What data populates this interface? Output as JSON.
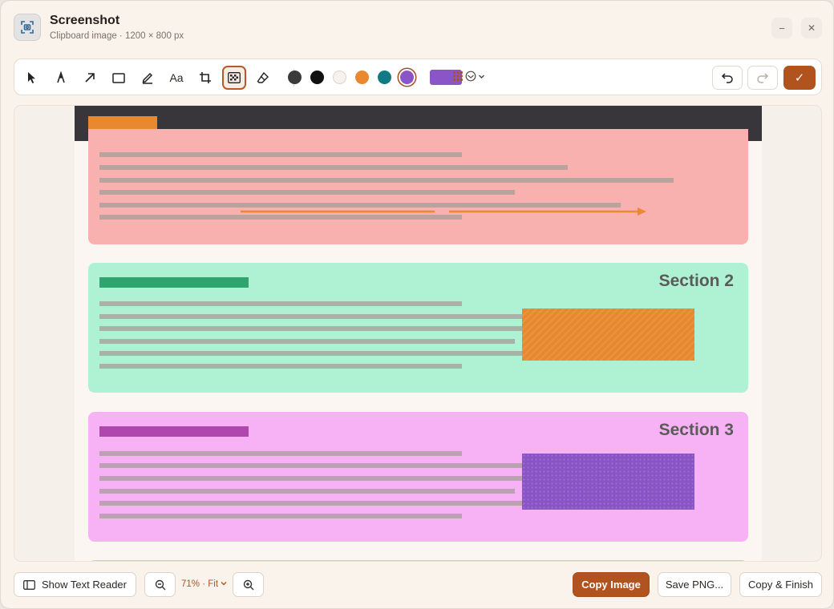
{
  "window": {
    "title": "Screenshot",
    "subtitle": "Clipboard image · 1200 × 800 px",
    "minimize_glyph": "−",
    "close_glyph": "✕",
    "app_icon": "screenshot-icon"
  },
  "toolbar": {
    "tools": [
      {
        "name": "select",
        "icon": "cursor-icon",
        "active": false
      },
      {
        "name": "pen",
        "icon": "pen-nib-icon",
        "active": false
      },
      {
        "name": "arrow",
        "icon": "arrow-icon",
        "active": false
      },
      {
        "name": "rectangle",
        "icon": "rectangle-icon",
        "active": false
      },
      {
        "name": "highlighter",
        "icon": "highlighter-icon",
        "active": false
      },
      {
        "name": "text",
        "label": "Aa",
        "active": false
      },
      {
        "name": "crop",
        "icon": "crop-icon",
        "active": false
      },
      {
        "name": "pixelate",
        "icon": "pixelate-icon",
        "active": true
      },
      {
        "name": "eraser",
        "icon": "eraser-icon",
        "active": false
      }
    ],
    "colors": [
      "#3a3a3c",
      "#111111",
      "#f7f2ee",
      "#e8892f",
      "#117a84",
      "#8a55c6"
    ],
    "selected_color": "#8a55c6",
    "undo_icon": "undo-icon",
    "redo_icon": "redo-icon",
    "done_glyph": "✓"
  },
  "canvas": {
    "colors": {
      "header": "#38363b",
      "section1": "#f8b1ae",
      "section2": "#aef2d3",
      "section3": "#f7b1f5",
      "accent_orange": "#e8892f",
      "accent_purple": "#8955c6"
    },
    "sections": [
      {
        "title": ""
      },
      {
        "title": "Section 2"
      },
      {
        "title": "Section 3"
      }
    ]
  },
  "bottom": {
    "text_reader_label": "Show Text Reader",
    "zoom_label": "71% · Fit",
    "copy_image_label": "Copy Image",
    "save_png_label": "Save PNG...",
    "copy_finish_label": "Copy & Finish"
  }
}
